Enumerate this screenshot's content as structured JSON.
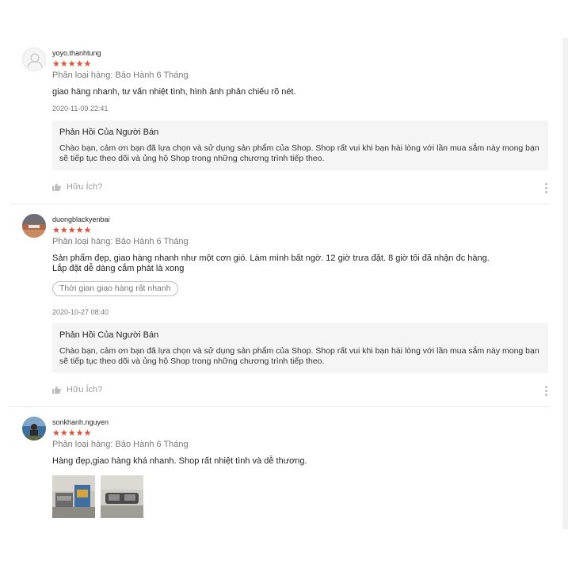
{
  "reviews": [
    {
      "username": "yoyo.thanhtung",
      "rating": 5,
      "stars": "★★★★★",
      "variation": "Phân loại hàng: Bảo Hành 6 Tháng",
      "comment": "giao hàng nhanh, tư vấn nhiệt tình, hình ảnh phản chiếu rõ nét.",
      "timestamp": "2020-11-09 22:41",
      "reply_title": "Phản Hồi Của Người Bán",
      "reply_line1": "Chào bạn, cảm ơn bạn đã lựa chọn và sử dụng sản phẩm của Shop. Shop rất vui khi bạn hài lòng với lần mua sắm này mong bạn",
      "reply_line2": "sẽ tiếp tục theo dõi và ủng hộ Shop trong những chương trình tiếp theo.",
      "helpful_label": "Hữu Ích?"
    },
    {
      "username": "duongblackyenbai",
      "rating": 5,
      "stars": "★★★★★",
      "variation": "Phân loại hàng: Bảo Hành 6 Tháng",
      "comment_line1": "Sản phẩm đẹp, giao hàng nhanh như một cơn gió. Làm mình bất ngờ. 12 giờ trưa đặt. 8 giờ tối đã nhận đc hàng.",
      "comment_line2": "Lắp đặt dễ dàng cắm phát là xong",
      "tag": "Thời gian giao hàng rất nhanh",
      "timestamp": "2020-10-27 08:40",
      "reply_title": "Phản Hồi Của Người Bán",
      "reply_line1": "Chào bạn, cảm ơn bạn đã lựa chọn và sử dụng sản phẩm của Shop. Shop rất vui khi bạn hài lòng với lần mua sắm này mong bạn",
      "reply_line2": "sẽ tiếp tục theo dõi và ủng hộ Shop trong những chương trình tiếp theo.",
      "helpful_label": "Hữu Ích?"
    },
    {
      "username": "sonkhanh.nguyen",
      "rating": 5,
      "stars": "★★★★★",
      "variation": "Phân loại hàng: Bảo Hành 6 Tháng",
      "comment": "Hàng đẹp,giao hàng khá nhanh. Shop rất nhiệt tình và dễ thương."
    }
  ],
  "colors": {
    "star": "#ee4d2d",
    "reply_bg": "#f5f5f5"
  },
  "icons": {
    "helpful": "thumbs-up-icon",
    "more": "more-vertical-icon",
    "default_avatar": "user-icon"
  }
}
